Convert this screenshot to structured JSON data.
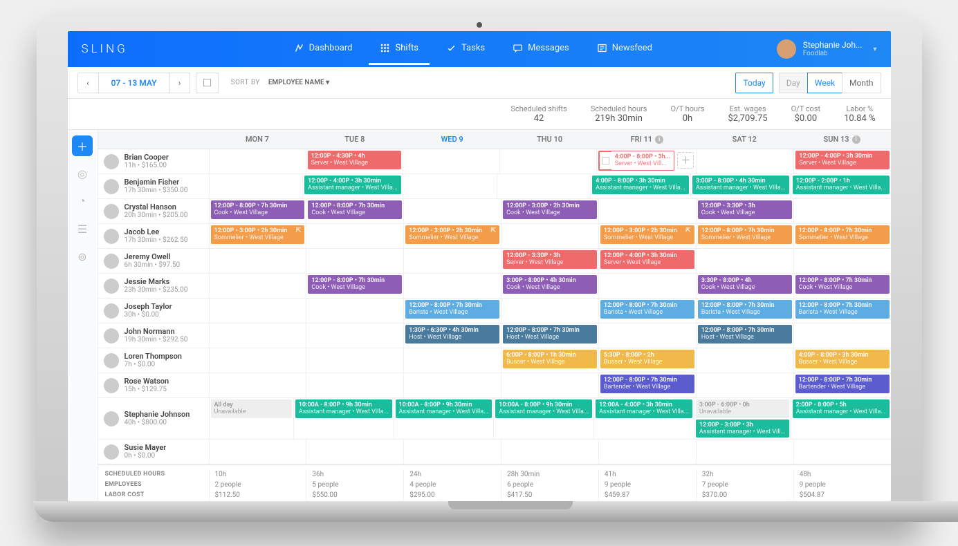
{
  "brand": "SLING",
  "nav": [
    {
      "label": "Dashboard",
      "icon": "dashboard"
    },
    {
      "label": "Shifts",
      "icon": "grid",
      "active": true
    },
    {
      "label": "Tasks",
      "icon": "check"
    },
    {
      "label": "Messages",
      "icon": "chat"
    },
    {
      "label": "Newsfeed",
      "icon": "news"
    }
  ],
  "user": {
    "name": "Stephanie Joh...",
    "org": "Foodlab"
  },
  "toolbar": {
    "date_range": "07 - 13 MAY",
    "sort_label": "SORT BY",
    "sort_value": "EMPLOYEE NAME",
    "today": "Today",
    "views": [
      "Day",
      "Week",
      "Month"
    ],
    "active_view": "Week"
  },
  "stats": [
    {
      "label": "Scheduled shifts",
      "value": "42"
    },
    {
      "label": "Scheduled hours",
      "value": "219h 30min"
    },
    {
      "label": "O/T hours",
      "value": "0h"
    },
    {
      "label": "Est. wages",
      "value": "$2,709.75"
    },
    {
      "label": "O/T cost",
      "value": "$0.00"
    },
    {
      "label": "Labor %",
      "value": "10.84 %"
    }
  ],
  "days": [
    {
      "label": "MON 7"
    },
    {
      "label": "TUE 8"
    },
    {
      "label": "WED 9",
      "today": true
    },
    {
      "label": "THU 10"
    },
    {
      "label": "FRI 11",
      "info": true
    },
    {
      "label": "SAT 12"
    },
    {
      "label": "SUN 13",
      "info": true
    }
  ],
  "employees": [
    {
      "name": "Brian Cooper",
      "sub": "11h • $165.00",
      "shifts": {
        "1": [
          {
            "t": "12:00P - 4:30P • 4h",
            "r": "Server • West Village",
            "c": "c-red"
          }
        ],
        "4": [
          {
            "t": "4:00P - 8:00P • 3h...",
            "r": "Server • West Vill...",
            "c": "c-red",
            "outline": true,
            "add_after": true
          }
        ],
        "6": [
          {
            "t": "12:00P - 4:00P • 3h 30min",
            "r": "Server • West Village",
            "c": "c-red"
          }
        ]
      }
    },
    {
      "name": "Benjamin Fisher",
      "sub": "17h 30min • $350.00",
      "shifts": {
        "1": [
          {
            "t": "12:00P - 4:00P • 3h 30min",
            "r": "Assistant manager • West Villa...",
            "c": "c-teal"
          }
        ],
        "4": [
          {
            "t": "4:00P - 8:00P • 3h 30min",
            "r": "Assistant manager • West Villa...",
            "c": "c-teal"
          }
        ],
        "5": [
          {
            "t": "3:00P - 8:00P • 4h 30min",
            "r": "Assistant manager • West Villa...",
            "c": "c-teal"
          }
        ],
        "6": [
          {
            "t": "12:00P - 2:00P • 1h",
            "r": "Assistant manager • West Villa...",
            "c": "c-teal"
          }
        ]
      }
    },
    {
      "name": "Crystal Hanson",
      "sub": "20h 30min • $205.00",
      "shifts": {
        "0": [
          {
            "t": "12:00P - 8:00P • 7h 30min",
            "r": "Cook • West Village",
            "c": "c-purple"
          }
        ],
        "1": [
          {
            "t": "12:00P - 8:00P • 7h 30min",
            "r": "Cook • West Village",
            "c": "c-purple"
          }
        ],
        "3": [
          {
            "t": "12:00P - 3:00P • 2h 30min",
            "r": "Cook • West Village",
            "c": "c-purple"
          }
        ],
        "5": [
          {
            "t": "12:00P - 3:30P • 3h",
            "r": "Cook • West Village",
            "c": "c-purple"
          }
        ]
      }
    },
    {
      "name": "Jacob Lee",
      "sub": "17h 30min • $262.50",
      "shifts": {
        "0": [
          {
            "t": "12:00P - 3:00P • 2h 30min",
            "r": "Sommelier • West Village",
            "c": "c-orange",
            "share": true
          }
        ],
        "2": [
          {
            "t": "12:00P - 3:00P • 2h 30min",
            "r": "Sommelier • West Village",
            "c": "c-orange",
            "share": true
          }
        ],
        "4": [
          {
            "t": "12:00P - 3:00P • 2h 30min",
            "r": "Sommelier • West Village",
            "c": "c-orange",
            "share": true
          }
        ],
        "5": [
          {
            "t": "12:00P - 8:00P • 7h 30min",
            "r": "Sommelier • West Village",
            "c": "c-orange"
          }
        ],
        "6": [
          {
            "t": "12:00P - 8:00P • 7h 30min",
            "r": "Sommelier • West Village",
            "c": "c-orange"
          }
        ]
      }
    },
    {
      "name": "Jeremy Owell",
      "sub": "6h 30min • $97.50",
      "shifts": {
        "3": [
          {
            "t": "12:00P - 3:30P • 3h",
            "r": "Server • West Village",
            "c": "c-red"
          }
        ],
        "4": [
          {
            "t": "12:00P - 4:00P • 3h 30min",
            "r": "Server • West Village",
            "c": "c-red"
          }
        ]
      }
    },
    {
      "name": "Jessie Marks",
      "sub": "23h 30min • $235.00",
      "shifts": {
        "1": [
          {
            "t": "12:00P - 8:00P • 7h 30min",
            "r": "Cook • West Village",
            "c": "c-purple"
          }
        ],
        "3": [
          {
            "t": "3:00P - 8:00P • 4h 30min",
            "r": "Cook • West Village",
            "c": "c-purple"
          }
        ],
        "5": [
          {
            "t": "3:30P - 8:00P • 4h",
            "r": "Cook • West Village",
            "c": "c-purple"
          }
        ],
        "6": [
          {
            "t": "12:00P - 8:00P • 7h 30min",
            "r": "Cook • West Village",
            "c": "c-purple"
          }
        ]
      }
    },
    {
      "name": "Joseph Taylor",
      "sub": "30h • $0.00",
      "shifts": {
        "2": [
          {
            "t": "12:00P - 8:00P • 7h 30min",
            "r": "Barista • West Village",
            "c": "c-blue"
          }
        ],
        "4": [
          {
            "t": "12:00P - 8:00P • 7h 30min",
            "r": "Barista • West Village",
            "c": "c-blue"
          }
        ],
        "5": [
          {
            "t": "12:00P - 8:00P • 7h 30min",
            "r": "Barista • West Village",
            "c": "c-blue"
          }
        ],
        "6": [
          {
            "t": "12:00P - 8:00P • 7h 30min",
            "r": "Barista • West Village",
            "c": "c-blue"
          }
        ]
      }
    },
    {
      "name": "John Normann",
      "sub": "19h 30min • $292.50",
      "shifts": {
        "2": [
          {
            "t": "1:30P - 6:30P • 4h 30min",
            "r": "Host • West Village",
            "c": "c-steel"
          }
        ],
        "3": [
          {
            "t": "12:00P - 8:00P • 7h 30min",
            "r": "Host • West Village",
            "c": "c-steel"
          }
        ],
        "5": [
          {
            "t": "12:00P - 8:00P • 7h 30min",
            "r": "Host • West Village",
            "c": "c-steel"
          }
        ]
      }
    },
    {
      "name": "Loren Thompson",
      "sub": "7h • $0.00",
      "shifts": {
        "3": [
          {
            "t": "6:00P - 8:00P • 1h 30min",
            "r": "Busser • West Village",
            "c": "c-yellow"
          }
        ],
        "4": [
          {
            "t": "5:30P - 8:00P • 2h",
            "r": "Busser • West Village",
            "c": "c-yellow"
          }
        ],
        "6": [
          {
            "t": "4:00P - 8:00P • 3h 30min",
            "r": "Busser • West Village",
            "c": "c-yellow"
          }
        ]
      }
    },
    {
      "name": "Rose Watson",
      "sub": "15h • $129.75",
      "shifts": {
        "4": [
          {
            "t": "12:00P - 8:00P • 7h 30min",
            "r": "Bartender • West Village",
            "c": "c-indigo"
          }
        ],
        "6": [
          {
            "t": "12:00P - 8:00P • 7h 30min",
            "r": "Bartender • West Village",
            "c": "c-indigo"
          }
        ]
      }
    },
    {
      "name": "Stephanie Johnson",
      "sub": "40h • $800.00",
      "shifts": {
        "0": [
          {
            "t": "All day",
            "r": "Unavailable",
            "c": "unavail"
          }
        ],
        "1": [
          {
            "t": "10:00A - 8:00P • 9h 30min",
            "r": "Assistant manager • West Villa...",
            "c": "c-teal"
          }
        ],
        "2": [
          {
            "t": "10:00A - 8:00P • 9h 30min",
            "r": "Assistant manager • West Villa...",
            "c": "c-teal"
          }
        ],
        "3": [
          {
            "t": "10:00A - 8:00P • 9h 30min",
            "r": "Assistant manager • West Villa...",
            "c": "c-teal"
          }
        ],
        "4": [
          {
            "t": "12:00A - 4:00P • 3h 30min",
            "r": "Assistant manager • West Villa...",
            "c": "c-teal"
          }
        ],
        "5": [
          {
            "t": "3:00P - 6:00P • 0h",
            "r": "Unavailable",
            "c": "unavail"
          },
          {
            "t": "12:00P - 3:00P • 3h",
            "r": "Assistant manager • West Vill...",
            "c": "c-teal"
          }
        ],
        "6": [
          {
            "t": "2:00P - 8:00P • 5h",
            "r": "Assistant manager • West Villa...",
            "c": "c-teal"
          }
        ]
      }
    },
    {
      "name": "Susie Mayer",
      "sub": "0h • $0.00",
      "shifts": {}
    }
  ],
  "summary": {
    "labels": [
      "SCHEDULED HOURS",
      "EMPLOYEES",
      "LABOR COST"
    ],
    "cols": [
      [
        "10h",
        "2 people",
        "$112.50"
      ],
      [
        "36h",
        "5 people",
        "$550.00"
      ],
      [
        "24h",
        "4 people",
        "$295.00"
      ],
      [
        "28h 30min",
        "6 people",
        "$417.50"
      ],
      [
        "41h",
        "9 people",
        "$459.87"
      ],
      [
        "32h",
        "7 people",
        "$370.00"
      ],
      [
        "48h",
        "9 people",
        "$504.87"
      ]
    ]
  }
}
